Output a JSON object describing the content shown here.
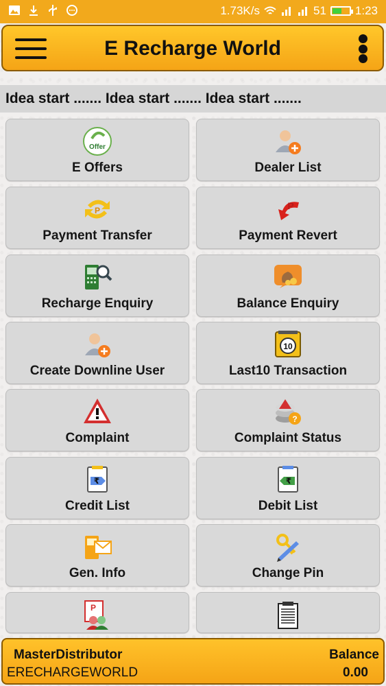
{
  "status_bar": {
    "speed": "1.73K/s",
    "battery": "51",
    "time": "1:23",
    "icons": [
      "image-icon",
      "download-icon",
      "usb-icon",
      "settings-icon",
      "wifi-icon",
      "signal-icon",
      "signal-icon",
      "battery-icon"
    ]
  },
  "app_bar": {
    "title": "E Recharge World",
    "menu_icon": "hamburger-menu-icon",
    "overflow_icon": "overflow-menu-icon"
  },
  "marquee": {
    "text": "Idea start ....... Idea start ....... Idea start ......."
  },
  "tiles": [
    {
      "label": "E Offers",
      "icon": "offer-icon"
    },
    {
      "label": "Dealer List",
      "icon": "user-add-icon"
    },
    {
      "label": "Payment Transfer",
      "icon": "payment-transfer-icon"
    },
    {
      "label": "Payment Revert",
      "icon": "payment-revert-icon"
    },
    {
      "label": "Recharge Enquiry",
      "icon": "recharge-enquiry-icon"
    },
    {
      "label": "Balance Enquiry",
      "icon": "money-bag-icon"
    },
    {
      "label": "Create Downline User",
      "icon": "user-add-icon"
    },
    {
      "label": "Last10 Transaction",
      "icon": "last10-icon"
    },
    {
      "label": "Complaint",
      "icon": "warning-icon"
    },
    {
      "label": "Complaint Status",
      "icon": "complaint-status-icon"
    },
    {
      "label": "Credit List",
      "icon": "credit-list-icon"
    },
    {
      "label": "Debit List",
      "icon": "debit-list-icon"
    },
    {
      "label": "Gen. Info",
      "icon": "gen-info-icon"
    },
    {
      "label": "Change Pin",
      "icon": "key-pencil-icon"
    },
    {
      "label": "",
      "icon": "users-report-icon"
    },
    {
      "label": "",
      "icon": "document-list-icon"
    }
  ],
  "footer": {
    "role": "MasterDistributor",
    "username": "ERECHARGEWORLD",
    "balance_label": "Balance",
    "balance_value": "0.00"
  },
  "colors": {
    "accent": "#f5a416",
    "tile_bg": "#d9d9d9",
    "marquee_bg": "#d6d6d6"
  }
}
